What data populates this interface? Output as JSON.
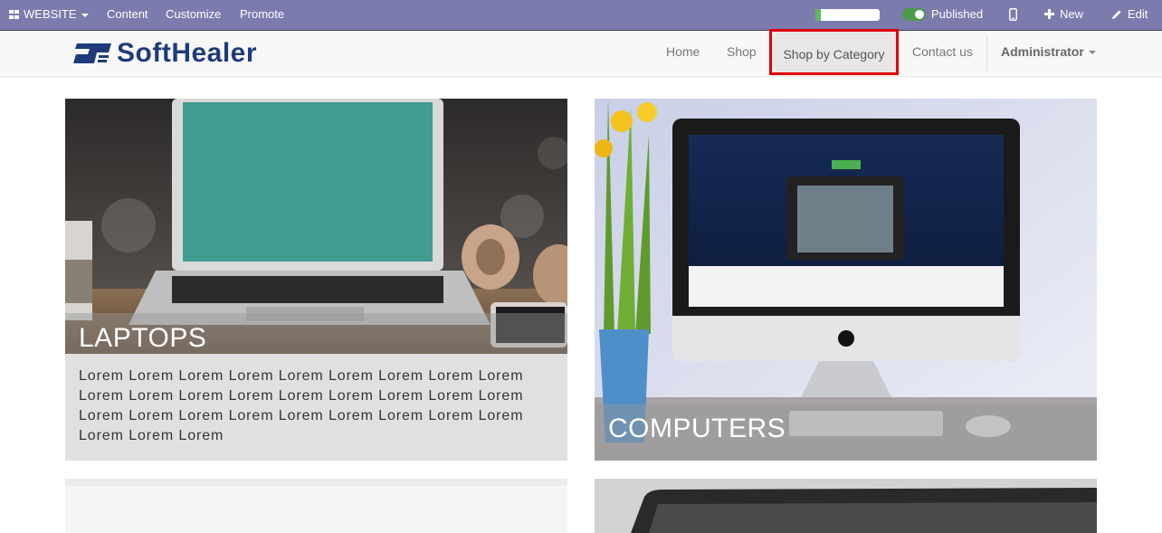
{
  "admin_bar": {
    "website_label": "WEBSITE",
    "content_label": "Content",
    "customize_label": "Customize",
    "promote_label": "Promote",
    "published_label": "Published",
    "new_label": "New",
    "edit_label": "Edit"
  },
  "navbar": {
    "brand": "SoftHealer",
    "links": [
      "Home",
      "Shop",
      "Shop by Category",
      "Contact us"
    ],
    "user_menu": "Administrator"
  },
  "categories": [
    {
      "name": "LAPTOPS",
      "description": "Lorem Lorem Lorem Lorem Lorem Lorem Lorem Lorem Lorem Lorem Lorem Lorem Lorem Lorem Lorem Lorem Lorem Lorem Lorem Lorem Lorem Lorem Lorem Lorem Lorem Lorem Lorem Lorem Lorem Lorem"
    },
    {
      "name": "COMPUTERS"
    }
  ],
  "colors": {
    "admin_bar": "#7c7bad",
    "highlight_border": "#e00000",
    "brand_blue": "#1f3b7a"
  }
}
